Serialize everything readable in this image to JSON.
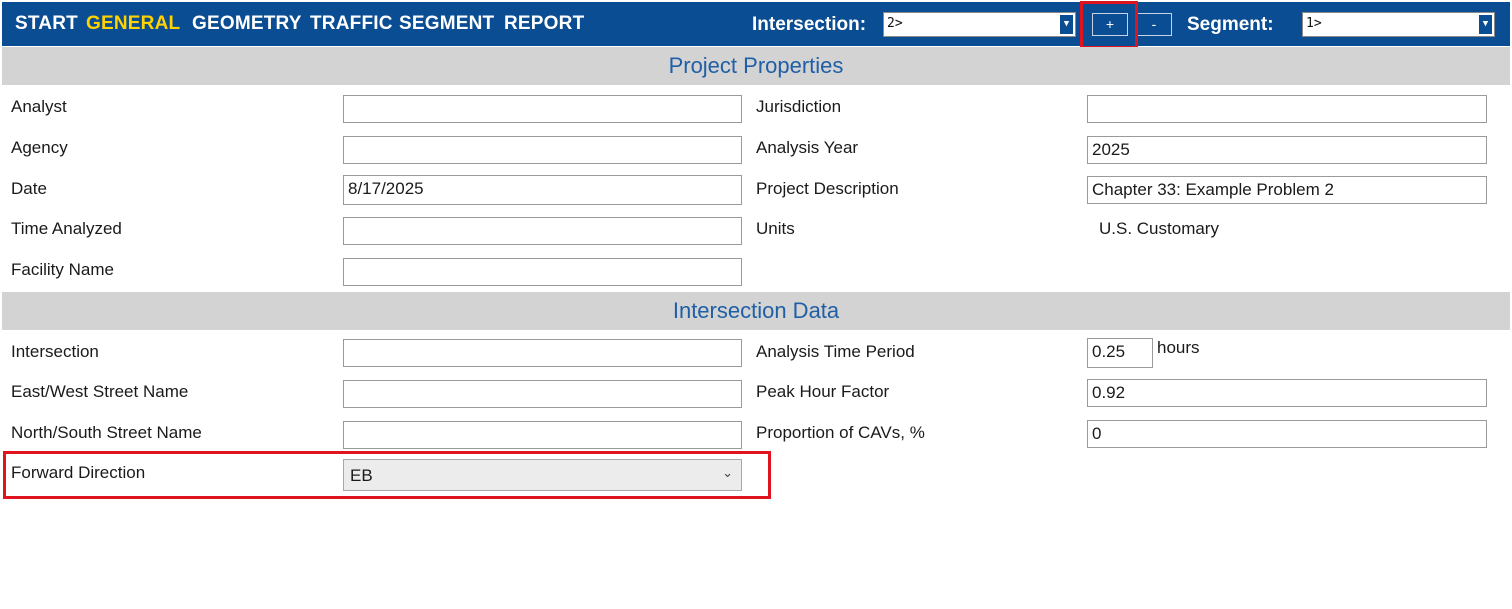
{
  "nav": {
    "items": [
      {
        "label": "START",
        "active": false
      },
      {
        "label": "GENERAL",
        "active": true
      },
      {
        "label": "GEOMETRY",
        "active": false
      },
      {
        "label": "TRAFFIC",
        "active": false
      },
      {
        "label": "SEGMENT",
        "active": false
      },
      {
        "label": "REPORT",
        "active": false
      }
    ],
    "intersection_label": "Intersection:",
    "intersection_value": "2>",
    "add_label": "+",
    "remove_label": "-",
    "segment_label": "Segment:",
    "segment_value": "1>"
  },
  "colors": {
    "topbar": "#0b4d92",
    "active_nav": "#ffd200",
    "section_header_bg": "#d3d3d3",
    "section_header_text": "#1f5fa6",
    "highlight": "#e0141e"
  },
  "project": {
    "title": "Project Properties",
    "analyst_label": "Analyst",
    "analyst_value": "",
    "agency_label": "Agency",
    "agency_value": "",
    "date_label": "Date",
    "date_value": "8/17/2025",
    "time_label": "Time Analyzed",
    "time_value": "",
    "facility_label": "Facility Name",
    "facility_value": "",
    "jurisdiction_label": "Jurisdiction",
    "jurisdiction_value": "",
    "year_label": "Analysis Year",
    "year_value": "2025",
    "description_label": "Project Description",
    "description_value": "Chapter 33: Example Problem 2",
    "units_label": "Units",
    "units_value": "U.S. Customary"
  },
  "intersection": {
    "title": "Intersection Data",
    "name_label": "Intersection",
    "name_value": "",
    "ew_label": "East/West Street Name",
    "ew_value": "",
    "ns_label": "North/South Street Name",
    "ns_value": "",
    "forward_label": "Forward Direction",
    "forward_value": "EB",
    "period_label": "Analysis Time Period",
    "period_value": "0.25",
    "period_unit": "hours",
    "phf_label": "Peak Hour Factor",
    "phf_value": "0.92",
    "cav_label": "Proportion of CAVs, %",
    "cav_value": "0"
  }
}
